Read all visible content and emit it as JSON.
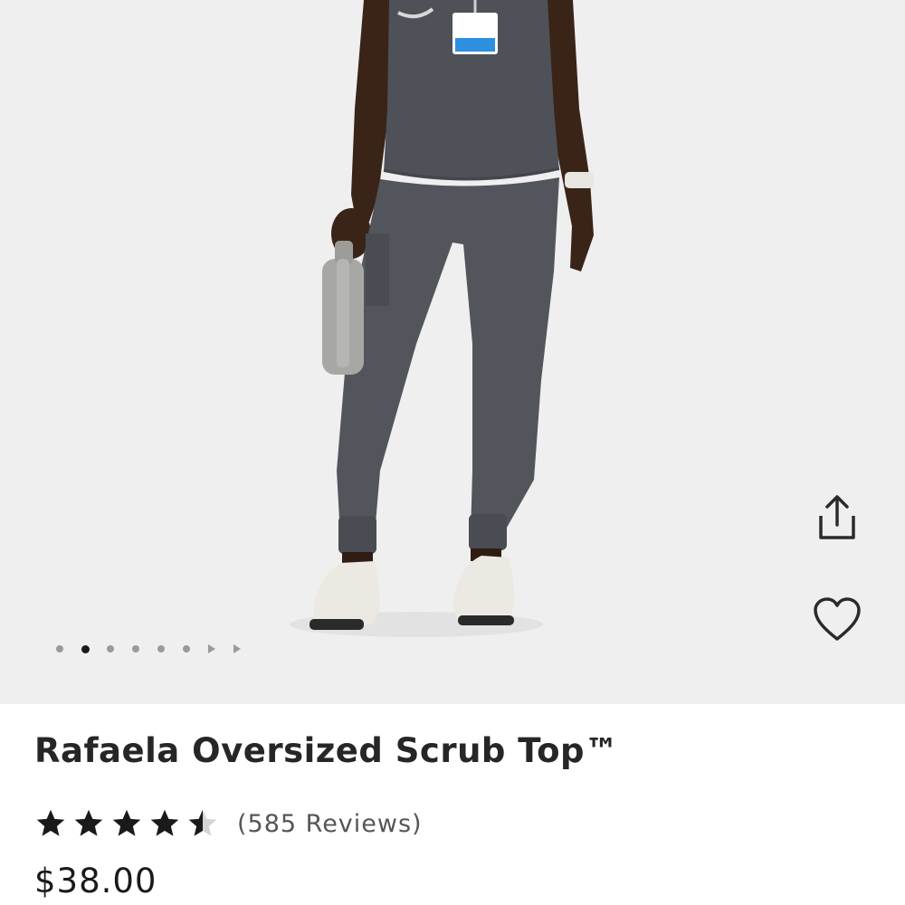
{
  "product": {
    "title": "Rafaela Oversized Scrub Top™",
    "rating": 4.5,
    "rating_max": 5,
    "reviews_label": "(585 Reviews)",
    "price": "$38.00"
  },
  "gallery": {
    "image_description": "Model wearing charcoal scrub top and jogger pants, holding a gray water bottle, white sneakers",
    "slide_count": 8,
    "active_slide": 2
  },
  "actions": {
    "share_icon": "share-icon",
    "favorite_icon": "heart-icon"
  },
  "colors": {
    "hero_background": "#efefef",
    "scrub": "#4f5158",
    "title_text": "#262626",
    "star": "#1a1a1a"
  }
}
